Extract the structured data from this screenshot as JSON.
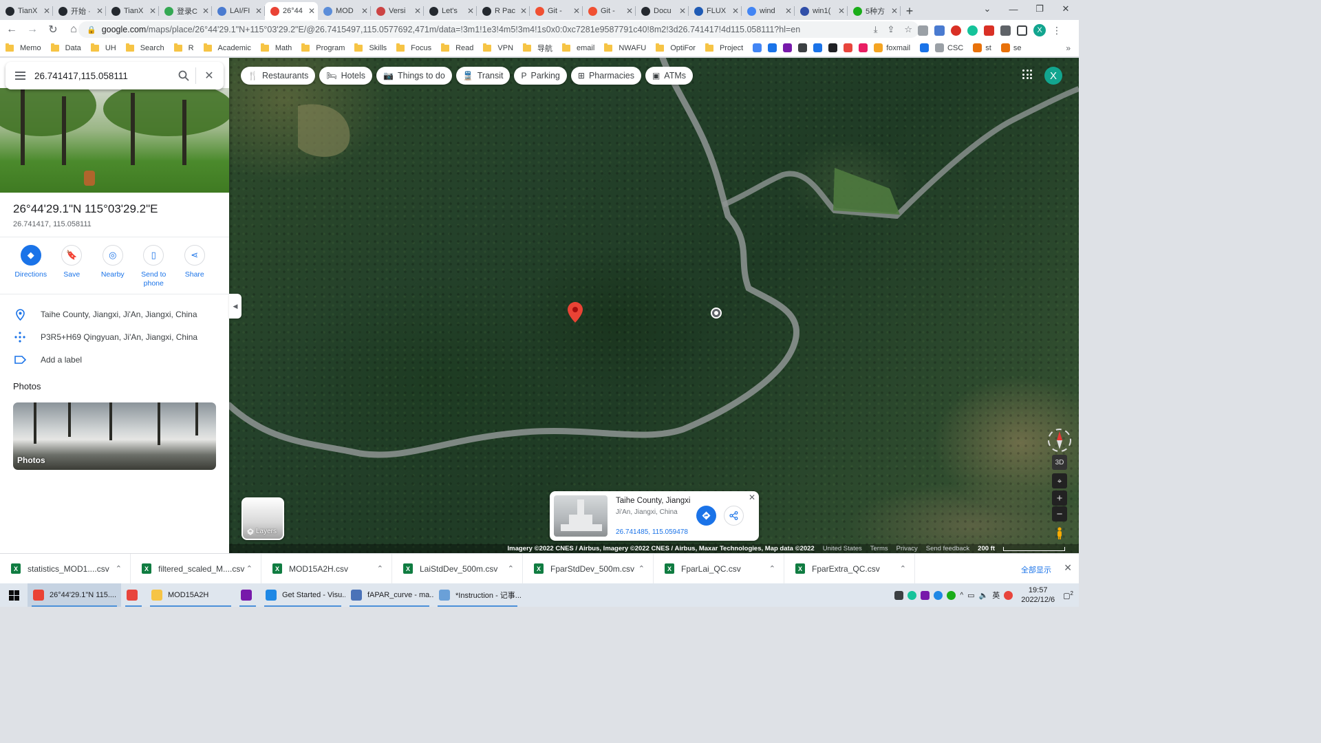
{
  "browser": {
    "tabs": [
      {
        "title": "TianX",
        "color": "#24292f"
      },
      {
        "title": "开始 ·",
        "color": "#24292f"
      },
      {
        "title": "TianX",
        "color": "#24292f"
      },
      {
        "title": "登录C",
        "color": "#34a853"
      },
      {
        "title": "LAI/FI",
        "color": "#4a7bd0"
      },
      {
        "title": "26°44",
        "color": "#ea4335",
        "active": true
      },
      {
        "title": "MOD",
        "color": "#5b8dd9"
      },
      {
        "title": "Versi",
        "color": "#c44"
      },
      {
        "title": "Let's",
        "color": "#24292f"
      },
      {
        "title": "R Pac",
        "color": "#24292f"
      },
      {
        "title": "Git -",
        "color": "#f05032"
      },
      {
        "title": "Git -",
        "color": "#f05032"
      },
      {
        "title": "Docu",
        "color": "#24292f"
      },
      {
        "title": "FLUX",
        "color": "#1f5bb5"
      },
      {
        "title": "wind",
        "color": "#4285f4"
      },
      {
        "title": "win1(",
        "color": "#2f4ea8"
      },
      {
        "title": "5种方",
        "color": "#1aad19"
      }
    ],
    "url_host": "google.com",
    "url_path": "/maps/place/26°44'29.1\"N+115°03'29.2\"E/@26.7415497,115.0577692,471m/data=!3m1!1e3!4m5!3m4!1s0x0:0xc7281e9587791c40!8m2!3d26.741417!4d115.058111?hl=en",
    "profile_letter": "X",
    "bookmarks": [
      {
        "label": "Memo",
        "type": "folder"
      },
      {
        "label": "Data",
        "type": "folder"
      },
      {
        "label": "UH",
        "type": "folder"
      },
      {
        "label": "Search",
        "type": "folder"
      },
      {
        "label": "R",
        "type": "folder"
      },
      {
        "label": "Academic",
        "type": "folder"
      },
      {
        "label": "Math",
        "type": "folder"
      },
      {
        "label": "Program",
        "type": "folder"
      },
      {
        "label": "Skills",
        "type": "folder"
      },
      {
        "label": "Focus",
        "type": "folder"
      },
      {
        "label": "Read",
        "type": "folder"
      },
      {
        "label": "VPN",
        "type": "folder"
      },
      {
        "label": "导航",
        "type": "folder"
      },
      {
        "label": "email",
        "type": "folder"
      },
      {
        "label": "NWAFU",
        "type": "folder"
      },
      {
        "label": "OptiFor",
        "type": "folder"
      },
      {
        "label": "Project",
        "type": "folder"
      },
      {
        "label": "",
        "type": "icon",
        "color": "#4285f4"
      },
      {
        "label": "",
        "type": "icon",
        "color": "#1a73e8"
      },
      {
        "label": "",
        "type": "icon",
        "color": "#7719aa"
      },
      {
        "label": "",
        "type": "icon",
        "color": "#3c4043"
      },
      {
        "label": "",
        "type": "icon",
        "color": "#1a73e8"
      },
      {
        "label": "",
        "type": "icon",
        "color": "#202124"
      },
      {
        "label": "",
        "type": "icon",
        "color": "#e8453c"
      },
      {
        "label": "",
        "type": "icon",
        "color": "#e91e63"
      },
      {
        "label": "foxmail",
        "type": "icon",
        "color": "#f4a422"
      },
      {
        "label": "",
        "type": "icon",
        "color": "#1a73e8"
      },
      {
        "label": "CSC",
        "type": "icon",
        "color": "#9aa0a6"
      },
      {
        "label": "st",
        "type": "icon",
        "color": "#e8710a"
      },
      {
        "label": "se",
        "type": "icon",
        "color": "#e8710a"
      }
    ]
  },
  "maps": {
    "search_value": "26.741417,115.058111",
    "place_title": "26°44'29.1\"N 115°03'29.2\"E",
    "place_coords": "26.741417, 115.058111",
    "actions": [
      {
        "label": "Directions",
        "icon": "directions-icon",
        "glyph": "◆",
        "filled": true
      },
      {
        "label": "Save",
        "icon": "bookmark-icon",
        "glyph": "🔖",
        "filled": false
      },
      {
        "label": "Nearby",
        "icon": "nearby-icon",
        "glyph": "◎",
        "filled": false
      },
      {
        "label": "Send to\nphone",
        "icon": "send-to-phone-icon",
        "glyph": "▯",
        "filled": false
      },
      {
        "label": "Share",
        "icon": "share-icon",
        "glyph": "⋖",
        "filled": false
      }
    ],
    "address": "Taihe County, Jiangxi, Ji'An, Jiangxi, China",
    "plus_code": "P3R5+H69 Qingyuan, Ji'An, Jiangxi, China",
    "add_label": "Add a label",
    "photos_heading": "Photos",
    "photos_label": "Photos",
    "chips": [
      {
        "label": "Restaurants",
        "icon": "restaurant-icon",
        "glyph": "🍴"
      },
      {
        "label": "Hotels",
        "icon": "hotel-icon",
        "glyph": "🛏"
      },
      {
        "label": "Things to do",
        "icon": "camera-icon",
        "glyph": "📷"
      },
      {
        "label": "Transit",
        "icon": "transit-icon",
        "glyph": "🚆"
      },
      {
        "label": "Parking",
        "icon": "parking-icon",
        "glyph": "P"
      },
      {
        "label": "Pharmacies",
        "icon": "pharmacy-icon",
        "glyph": "⊞"
      },
      {
        "label": "ATMs",
        "icon": "atm-icon",
        "glyph": "▣"
      }
    ],
    "map_avatar": "X",
    "layers_label": "Layers",
    "card": {
      "title": "Taihe County, Jiangxi",
      "subtitle": "Ji'An, Jiangxi, China",
      "coords": "26.741485, 115.059478"
    },
    "controls": {
      "threed": "3D"
    },
    "attribution": {
      "imagery": "Imagery ©2022 CNES / Airbus, Imagery ©2022 CNES / Airbus, Maxar Technologies, Map data ©2022",
      "country": "United States",
      "terms": "Terms",
      "privacy": "Privacy",
      "feedback": "Send feedback",
      "scale": "200 ft"
    }
  },
  "downloads": {
    "items": [
      "statistics_MOD1....csv",
      "filtered_scaled_M....csv",
      "MOD15A2H.csv",
      "LaiStdDev_500m.csv",
      "FparStdDev_500m.csv",
      "FparLai_QC.csv",
      "FparExtra_QC.csv"
    ],
    "show_all": "全部显示"
  },
  "taskbar": {
    "items": [
      {
        "label": "26°44'29.1\"N 115....",
        "color": "#ea4335",
        "active": true,
        "width": 136
      },
      {
        "label": "",
        "color": "#e8453c",
        "active": false,
        "width": 36
      },
      {
        "label": "MOD15A2H",
        "color": "#f6c445",
        "active": false,
        "width": 130
      },
      {
        "label": "",
        "color": "#7719aa",
        "active": false,
        "width": 36
      },
      {
        "label": "Get Started - Visu...",
        "color": "#1e88e5",
        "active": false,
        "width": 124
      },
      {
        "label": "fAPAR_curve - ma...",
        "color": "#4a72b8",
        "active": false,
        "width": 128
      },
      {
        "label": "*Instruction - 记事...",
        "color": "#6aa0d8",
        "active": false,
        "width": 128
      }
    ],
    "ime": "英",
    "time": "19:57",
    "date": "2022/12/6",
    "notif_count": "2"
  }
}
